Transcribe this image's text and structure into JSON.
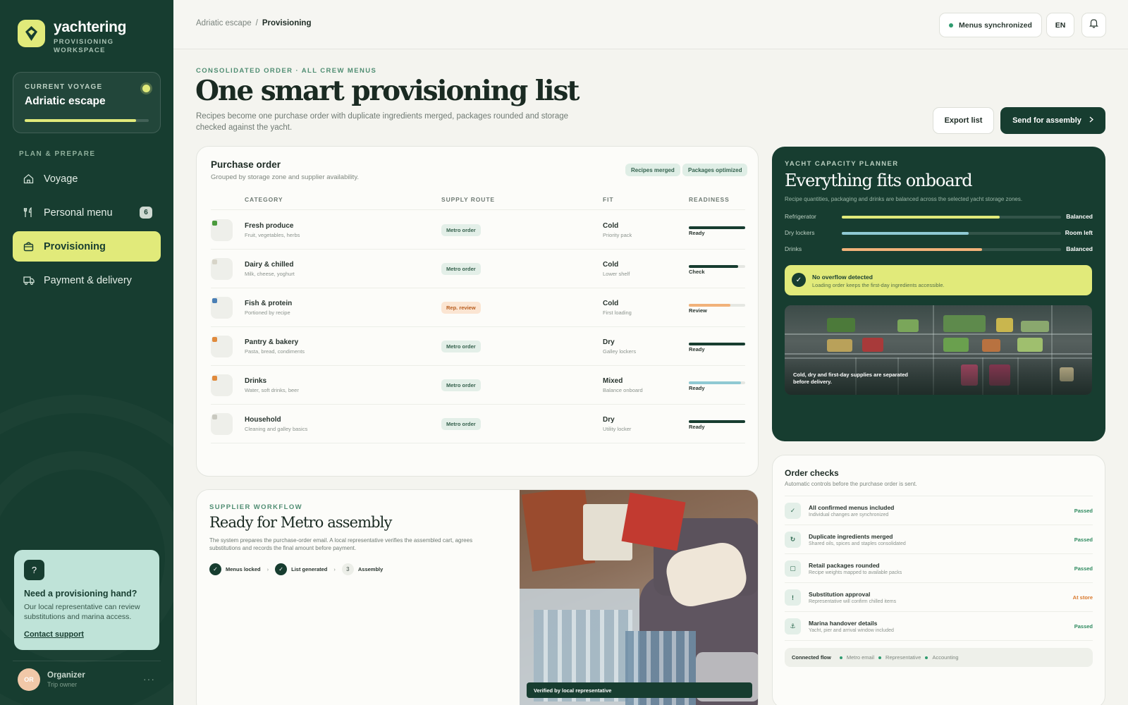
{
  "brand": {
    "name": "yachtering",
    "subtitle": "PROVISIONING WORKSPACE"
  },
  "voyage": {
    "label": "CURRENT VOYAGE",
    "name": "Adriatic escape",
    "progress": 0.9
  },
  "nav": {
    "title": "PLAN & PREPARE",
    "items": [
      {
        "label": "Voyage",
        "icon": "home-icon"
      },
      {
        "label": "Personal menu",
        "icon": "utensils-icon",
        "badge": "6"
      },
      {
        "label": "Provisioning",
        "icon": "bag-icon",
        "active": true
      },
      {
        "label": "Payment & delivery",
        "icon": "truck-icon"
      }
    ]
  },
  "help": {
    "icon": "?",
    "title": "Need a provisioning hand?",
    "text": "Our local representative can review substitutions and marina access.",
    "link": "Contact support"
  },
  "user": {
    "initials": "OR",
    "name": "Organizer",
    "role": "Trip owner",
    "more": "···"
  },
  "topbar": {
    "breadcrumb": [
      "Adriatic escape",
      "Provisioning"
    ],
    "separator": "/",
    "sync_status": "Menus synchronized",
    "language": "EN"
  },
  "hero": {
    "eyebrow": "CONSOLIDATED ORDER · ALL CREW MENUS",
    "title": "One smart provisioning list",
    "subtitle": "Recipes become one purchase order with duplicate ingredients merged, packages rounded and storage checked against the yacht.",
    "export_label": "Export list",
    "send_label": "Send for assembly"
  },
  "purchase_order": {
    "title": "Purchase order",
    "subtitle": "Grouped by storage zone and supplier availability.",
    "tags": [
      "Recipes merged",
      "Packages optimized"
    ],
    "columns": [
      "CATEGORY",
      "SUPPLY ROUTE",
      "FIT",
      "READINESS"
    ],
    "rows": [
      {
        "name": "Fresh produce",
        "desc": "Fruit, vegetables, herbs",
        "route": "Metro order",
        "route_type": "metro",
        "fit": "Cold",
        "fit_desc": "Priority pack",
        "readiness": "Ready",
        "level": 1.0,
        "color": "#173d30",
        "thumb": "#4a9a3c"
      },
      {
        "name": "Dairy & chilled",
        "desc": "Milk, cheese, yoghurt",
        "route": "Metro order",
        "route_type": "metro",
        "fit": "Cold",
        "fit_desc": "Lower shelf",
        "readiness": "Check",
        "level": 0.88,
        "color": "#173d30",
        "thumb": "#d7d4c8"
      },
      {
        "name": "Fish & protein",
        "desc": "Portioned by recipe",
        "route": "Rep. review",
        "route_type": "review",
        "fit": "Cold",
        "fit_desc": "First loading",
        "readiness": "Review",
        "level": 0.74,
        "color": "#f1b27a",
        "thumb": "#4a7fb5"
      },
      {
        "name": "Pantry & bakery",
        "desc": "Pasta, bread, condiments",
        "route": "Metro order",
        "route_type": "metro",
        "fit": "Dry",
        "fit_desc": "Galley lockers",
        "readiness": "Ready",
        "level": 1.0,
        "color": "#173d30",
        "thumb": "#e08a3c"
      },
      {
        "name": "Drinks",
        "desc": "Water, soft drinks, beer",
        "route": "Metro order",
        "route_type": "metro",
        "fit": "Mixed",
        "fit_desc": "Balance onboard",
        "readiness": "Ready",
        "level": 0.92,
        "color": "#8fc9d3",
        "thumb": "#e08a3c"
      },
      {
        "name": "Household",
        "desc": "Cleaning and galley basics",
        "route": "Metro order",
        "route_type": "metro",
        "fit": "Dry",
        "fit_desc": "Utility locker",
        "readiness": "Ready",
        "level": 1.0,
        "color": "#173d30",
        "thumb": "#c9c9c0"
      }
    ]
  },
  "planner": {
    "eyebrow": "YACHT CAPACITY PLANNER",
    "title": "Everything fits onboard",
    "subtitle": "Recipe quantities, packaging and drinks are balanced across the selected yacht storage zones.",
    "zones": [
      {
        "name": "Refrigerator",
        "level": 0.72,
        "status": "Balanced",
        "color": "#e1ea7a"
      },
      {
        "name": "Dry lockers",
        "level": 0.58,
        "status": "Room left",
        "color": "#8fc9d3"
      },
      {
        "name": "Drinks",
        "level": 0.64,
        "status": "Balanced",
        "color": "#f1b27a"
      }
    ],
    "overflow_title": "No overflow detected",
    "overflow_text": "Loading order keeps the first-day ingredients accessible.",
    "photo_caption": "Cold, dry and first-day supplies are separated before delivery."
  },
  "order_checks": {
    "title": "Order checks",
    "subtitle": "Automatic controls before the purchase order is sent.",
    "items": [
      {
        "icon": "✓",
        "title": "All confirmed menus included",
        "desc": "Individual changes are synchronized",
        "status": "Passed",
        "color": "#2e8a5f"
      },
      {
        "icon": "↻",
        "title": "Duplicate ingredients merged",
        "desc": "Shared oils, spices and staples consolidated",
        "status": "Passed",
        "color": "#2e8a5f"
      },
      {
        "icon": "▢",
        "title": "Retail packages rounded",
        "desc": "Recipe weights mapped to available packs",
        "status": "Passed",
        "color": "#2e8a5f"
      },
      {
        "icon": "!",
        "title": "Substitution approval",
        "desc": "Representative will confirm chilled items",
        "status": "At store",
        "color": "#d9782c"
      },
      {
        "icon": "⚓",
        "title": "Marina handover details",
        "desc": "Yacht, pier and arrival window included",
        "status": "Passed",
        "color": "#2e8a5f"
      }
    ],
    "flow_label": "Connected flow",
    "flow": [
      "Metro email",
      "Representative",
      "Accounting"
    ]
  },
  "supplier": {
    "eyebrow": "SUPPLIER WORKFLOW",
    "title": "Ready for Metro assembly",
    "subtitle": "The system prepares the purchase-order email. A local representative verifies the assembled cart, agrees substitutions and records the final amount before payment.",
    "steps": [
      {
        "mark": "✓",
        "label": "Menus locked",
        "done": true
      },
      {
        "mark": "✓",
        "label": "List generated",
        "done": true
      },
      {
        "mark": "3",
        "label": "Assembly",
        "done": false
      }
    ],
    "arrow": "›",
    "photo_badge": "Verified by local representative"
  }
}
